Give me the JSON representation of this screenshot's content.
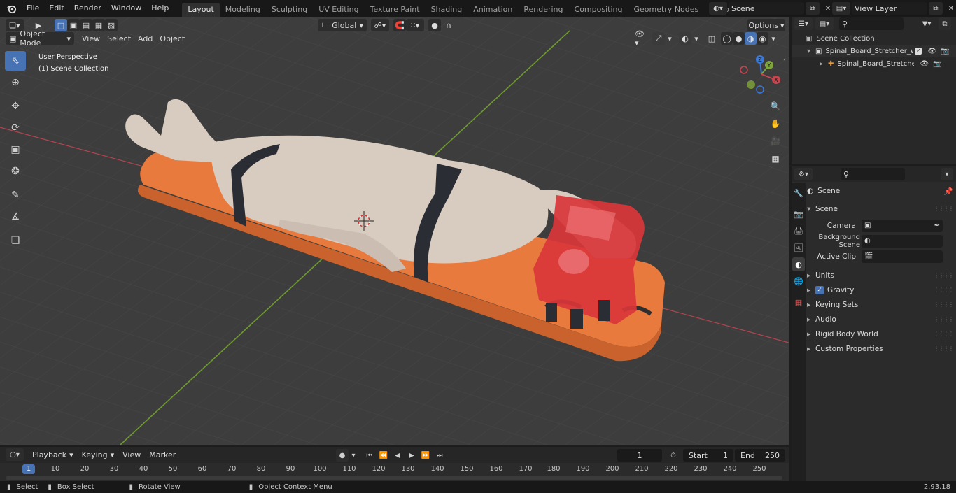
{
  "menu": [
    "File",
    "Edit",
    "Render",
    "Window",
    "Help"
  ],
  "workspaces": [
    "Layout",
    "Modeling",
    "Sculpting",
    "UV Editing",
    "Texture Paint",
    "Shading",
    "Animation",
    "Rendering",
    "Compositing",
    "Geometry Nodes",
    "Scripting"
  ],
  "active_workspace": "Layout",
  "scene_field": "Scene",
  "view_layer_field": "View Layer",
  "viewport": {
    "mode": "Object Mode",
    "menus": [
      "View",
      "Select",
      "Add",
      "Object"
    ],
    "orientation": "Global",
    "options_label": "Options",
    "overlay_line1": "User Perspective",
    "overlay_line2": "(1) Scene Collection"
  },
  "gizmo": {
    "x": "X",
    "y": "Y",
    "z": "Z"
  },
  "outliner": {
    "root": "Scene Collection",
    "items": [
      {
        "name": "Spinal_Board_Stretcher_with_"
      },
      {
        "name": "Spinal_Board_Stretcher_v"
      }
    ]
  },
  "properties": {
    "header_title": "Scene",
    "panel": "Scene",
    "fields": [
      {
        "label": "Camera"
      },
      {
        "label": "Background Scene"
      },
      {
        "label": "Active Clip"
      }
    ],
    "subpanels": [
      "Units",
      "Gravity",
      "Keying Sets",
      "Audio",
      "Rigid Body World",
      "Custom Properties"
    ]
  },
  "timeline": {
    "menus": [
      "Playback",
      "Keying",
      "View",
      "Marker"
    ],
    "current_frame": "1",
    "start_label": "Start",
    "start_value": "1",
    "end_label": "End",
    "end_value": "250",
    "ruler": [
      "1",
      "10",
      "20",
      "30",
      "40",
      "50",
      "60",
      "70",
      "80",
      "90",
      "100",
      "110",
      "120",
      "130",
      "140",
      "150",
      "160",
      "170",
      "180",
      "190",
      "200",
      "210",
      "220",
      "230",
      "240",
      "250"
    ]
  },
  "status": {
    "select": "Select",
    "box_select": "Box Select",
    "rotate_view": "Rotate View",
    "context_menu": "Object Context Menu",
    "version": "2.93.18"
  },
  "colors": {
    "accent": "#4772b3",
    "stretcher": "#e87a3e",
    "head_immobilizer": "#d9363a",
    "figure": "#d8cbc0",
    "strap": "#2a2d33",
    "x_axis": "#c8454f",
    "y_axis": "#7fa63a",
    "viewport_bg": "#3d3d3d"
  }
}
